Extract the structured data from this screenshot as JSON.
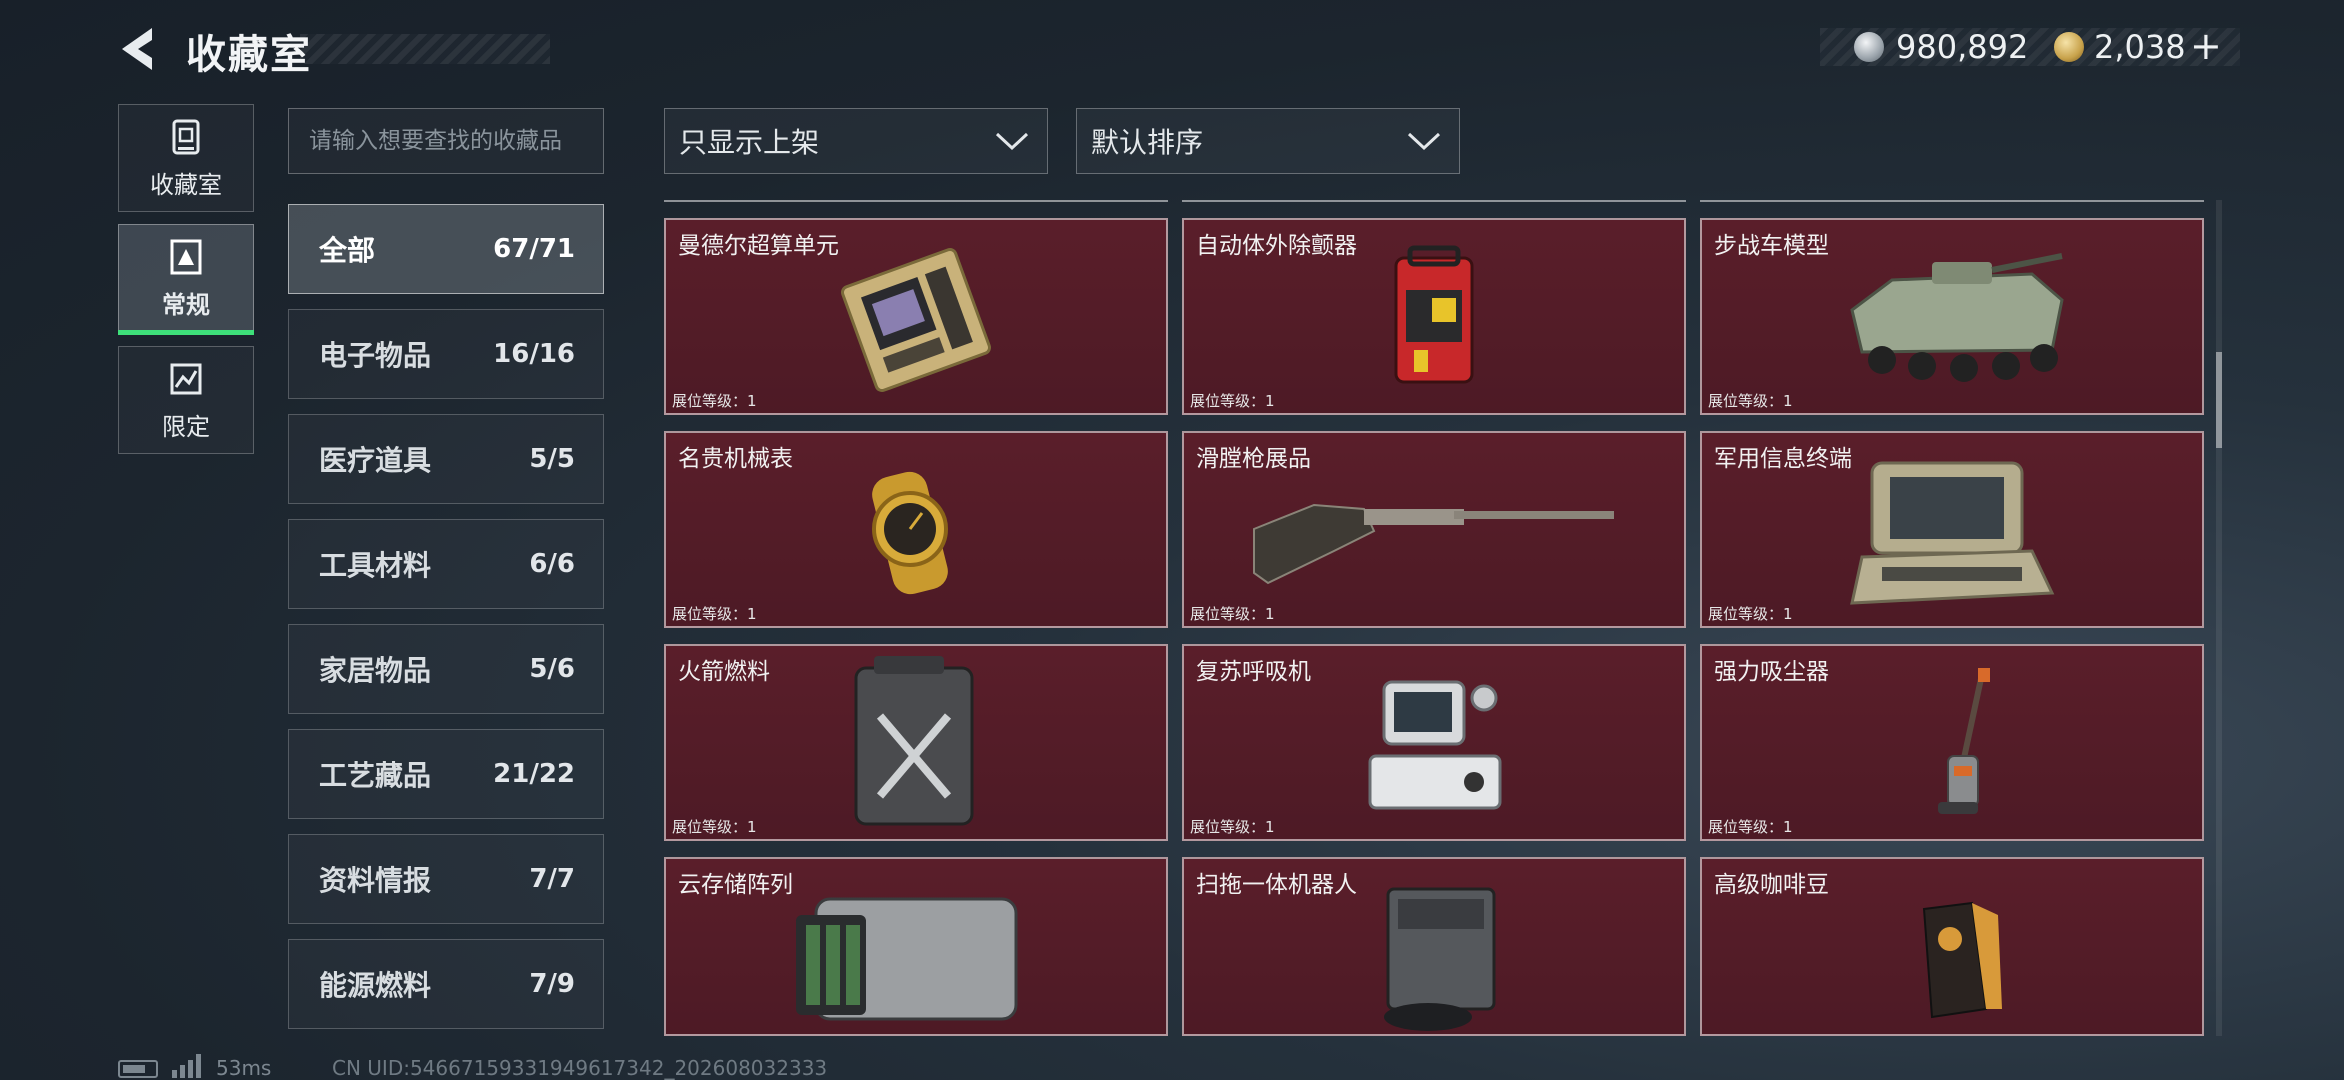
{
  "header": {
    "title": "收藏室",
    "silver_amount": "980,892",
    "gold_amount": "2,038",
    "add_label": "+"
  },
  "side_tabs": [
    {
      "label": "收藏室",
      "icon": "collection-icon",
      "active": false
    },
    {
      "label": "常规",
      "icon": "regular-icon",
      "active": true
    },
    {
      "label": "限定",
      "icon": "limited-icon",
      "active": false
    }
  ],
  "search": {
    "placeholder": "请输入想要查找的收藏品"
  },
  "filters": {
    "show_filter": "只显示上架",
    "sort_order": "默认排序"
  },
  "categories": [
    {
      "name": "全部",
      "count": "67/71",
      "active": true
    },
    {
      "name": "电子物品",
      "count": "16/16"
    },
    {
      "name": "医疗道具",
      "count": "5/5"
    },
    {
      "name": "工具材料",
      "count": "6/6"
    },
    {
      "name": "家居物品",
      "count": "5/6"
    },
    {
      "name": "工艺藏品",
      "count": "21/22"
    },
    {
      "name": "资料情报",
      "count": "7/7"
    },
    {
      "name": "能源燃料",
      "count": "7/9"
    }
  ],
  "level_label": "展位等级：1",
  "items": [
    {
      "name": "曼德尔超算单元",
      "icon": "computing-unit-icon"
    },
    {
      "name": "自动体外除颤器",
      "icon": "defibrillator-icon"
    },
    {
      "name": "步战车模型",
      "icon": "ifv-model-icon"
    },
    {
      "name": "名贵机械表",
      "icon": "watch-icon"
    },
    {
      "name": "滑膛枪展品",
      "icon": "musket-icon"
    },
    {
      "name": "军用信息终端",
      "icon": "military-terminal-icon"
    },
    {
      "name": "火箭燃料",
      "icon": "fuel-can-icon"
    },
    {
      "name": "复苏呼吸机",
      "icon": "ventilator-icon"
    },
    {
      "name": "强力吸尘器",
      "icon": "vacuum-icon"
    },
    {
      "name": "云存储阵列",
      "icon": "storage-array-icon"
    },
    {
      "name": "扫拖一体机器人",
      "icon": "robot-mop-icon"
    },
    {
      "name": "高级咖啡豆",
      "icon": "coffee-bag-icon"
    }
  ],
  "footer": {
    "ping": "53ms",
    "uid": "CN UID:54667159331949617342_202608032333"
  }
}
